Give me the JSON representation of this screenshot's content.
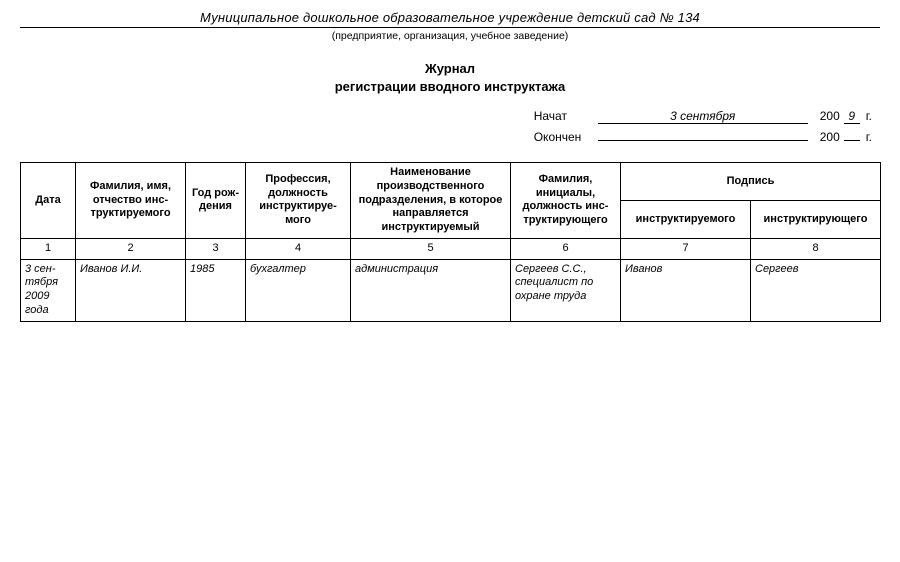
{
  "org": {
    "title": "Муниципальное дошкольное образовательное учреждение детский сад № 134",
    "subtitle": "(предприятие, организация, учебное заведение)"
  },
  "journal": {
    "line1": "Журнал",
    "line2": "регистрации вводного инструктажа"
  },
  "dates": {
    "start_label": "Начат",
    "start_value": "3 сентября",
    "start_year_prefix": "200",
    "start_year_digit": "9",
    "end_label": "Окончен",
    "end_value": "",
    "end_year_prefix": "200",
    "end_year_digit": "",
    "year_suffix": "г."
  },
  "headers": {
    "date": "Дата",
    "fio": "Фамилия, имя, отчество инс­труктируемого",
    "birth": "Год рож­дения",
    "profession": "Профессия, должность инструктируе­мого",
    "department": "Наименование производственного подразделения, в которое направляется инструктируемый",
    "instructor": "Фамилия, инициалы, должность инс­труктирующего",
    "sign": "Подпись",
    "sign_instructee": "инструктируемого",
    "sign_instructor": "инструктирующего"
  },
  "colnums": {
    "c1": "1",
    "c2": "2",
    "c3": "3",
    "c4": "4",
    "c5": "5",
    "c6": "6",
    "c7": "7",
    "c8": "8"
  },
  "row": {
    "date": "3 сен­тября 2009 года",
    "fio": "Иванов И.И.",
    "birth": "1985",
    "profession": "бухгалтер",
    "department": "администрация",
    "instructor": "Сергеев С.С., специалист по охране труда",
    "sign_instructee": "Иванов",
    "sign_instructor": "Сергеев"
  }
}
